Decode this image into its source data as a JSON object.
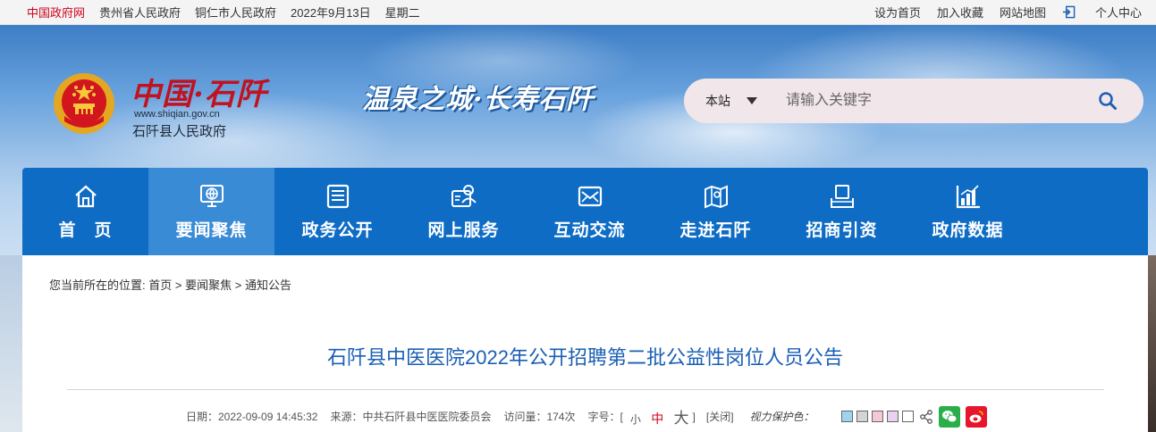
{
  "topbar": {
    "gov_portal": "中国政府网",
    "province": "贵州省人民政府",
    "city": "铜仁市人民政府",
    "date": "2022年9月13日",
    "weekday": "星期二",
    "set_home": "设为首页",
    "favorite": "加入收藏",
    "sitemap": "网站地图",
    "personal": "个人中心"
  },
  "header": {
    "logo_text": "中国·石阡",
    "logo_url": "www.shiqian.gov.cn",
    "org_name": "石阡县人民政府",
    "slogan": "温泉之城·长寿石阡",
    "search_scope": "本站",
    "search_placeholder": "请输入关键字"
  },
  "nav": [
    {
      "label": "首　页",
      "icon": "home-icon"
    },
    {
      "label": "要闻聚焦",
      "icon": "globe-monitor-icon"
    },
    {
      "label": "政务公开",
      "icon": "document-icon"
    },
    {
      "label": "网上服务",
      "icon": "user-card-icon"
    },
    {
      "label": "互动交流",
      "icon": "mail-icon"
    },
    {
      "label": "走进石阡",
      "icon": "map-icon"
    },
    {
      "label": "招商引资",
      "icon": "handshake-icon"
    },
    {
      "label": "政府数据",
      "icon": "bar-chart-icon"
    }
  ],
  "breadcrumb": {
    "prefix": "您当前所在的位置:",
    "home": "首页",
    "sep": ">",
    "level1": "要闻聚焦",
    "level2": "通知公告"
  },
  "article": {
    "title": "石阡县中医医院2022年公开招聘第二批公益性岗位人员公告",
    "date": "日期：2022-09-09 14:45:32",
    "source": "来源：中共石阡县中医医院委员会",
    "views": "访问量：174次",
    "fontsize_label": "字号：[",
    "font_small": "小",
    "font_mid": "中",
    "font_big": "大",
    "fontsize_end": "]",
    "close": "[关闭]",
    "eye_care": "视力保护色：",
    "swatches": [
      "#9fd4ee",
      "#d4d4d4",
      "#f4c8d6",
      "#ecd0f2",
      "#ffffff"
    ]
  },
  "colors": {
    "nav_bg": "#0e6cc4",
    "nav_active": "#3a8bd6",
    "title": "#1a5fb4",
    "gov_red": "#d0021b"
  }
}
